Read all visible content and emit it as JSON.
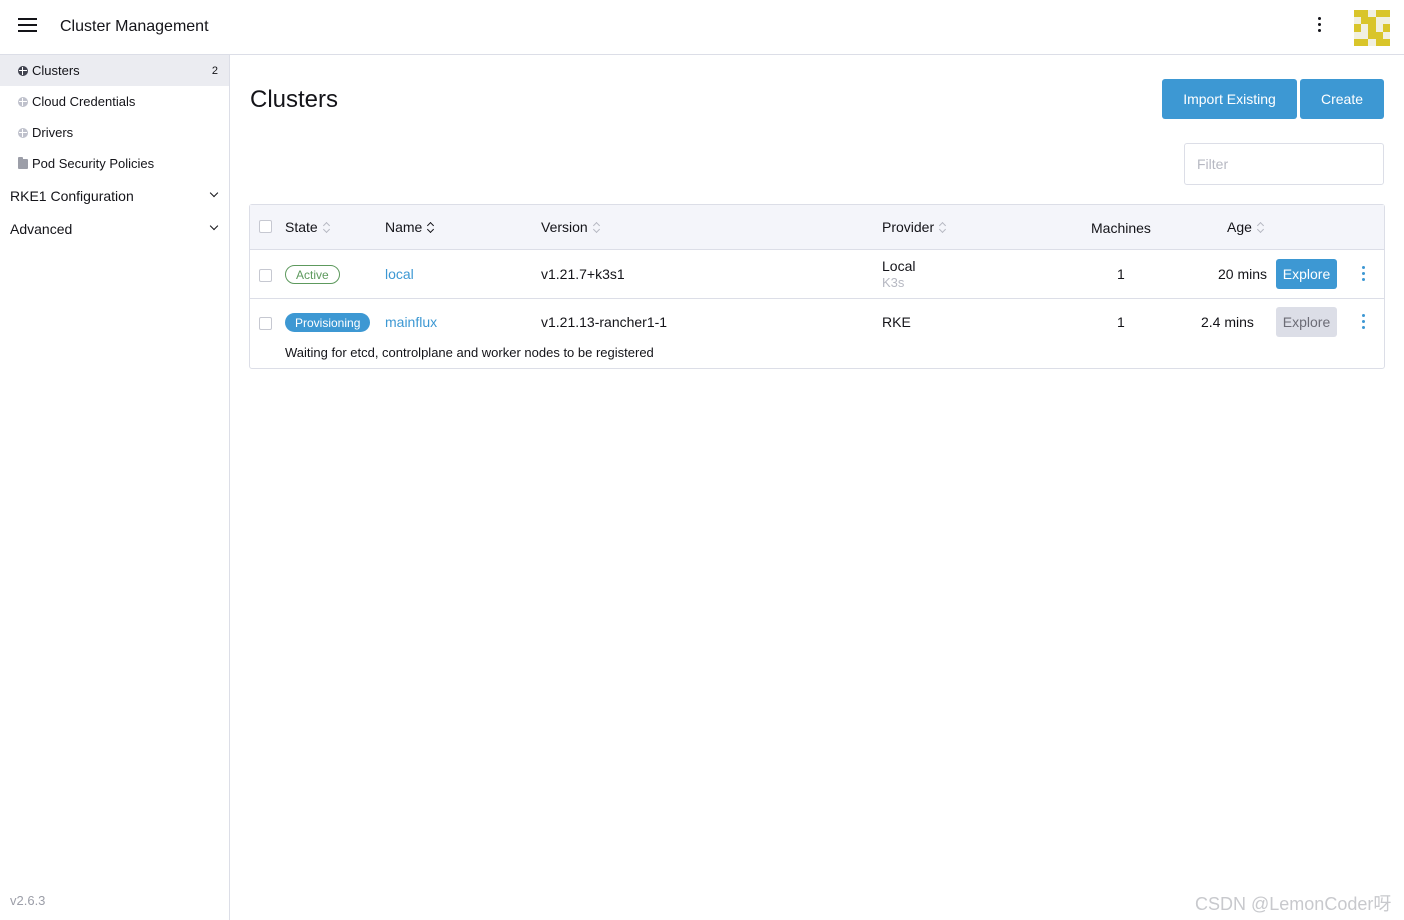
{
  "header": {
    "title": "Cluster Management",
    "menu_icon": "hamburger-icon",
    "more_icon": "kebab-icon",
    "avatar_colors": {
      "fg": "#d9c52a",
      "bg": "#f1f0e0"
    }
  },
  "sidebar": {
    "items": [
      {
        "label": "Clusters",
        "count": "2",
        "icon": "globe-icon",
        "active": true
      },
      {
        "label": "Cloud Credentials",
        "icon": "globe-icon"
      },
      {
        "label": "Drivers",
        "icon": "globe-icon"
      },
      {
        "label": "Pod Security Policies",
        "icon": "folder-icon"
      }
    ],
    "groups": [
      {
        "label": "RKE1 Configuration",
        "icon": "chevron-down-icon"
      },
      {
        "label": "Advanced",
        "icon": "chevron-down-icon"
      }
    ],
    "version": "v2.6.3"
  },
  "main": {
    "title": "Clusters",
    "import_label": "Import Existing",
    "create_label": "Create",
    "filter_placeholder": "Filter",
    "accent_color": "#3d98d3",
    "table": {
      "columns": [
        "State",
        "Name",
        "Version",
        "Provider",
        "Machines",
        "Age"
      ],
      "rows": [
        {
          "state": "Active",
          "name": "local",
          "version": "v1.21.7+k3s1",
          "provider": "Local",
          "provider_sub": "K3s",
          "machines": "1",
          "age": "20 mins",
          "action": "Explore"
        },
        {
          "state": "Provisioning",
          "name": "mainflux",
          "version": "v1.21.13-rancher1-1",
          "provider": "RKE",
          "machines": "1",
          "age": "2.4 mins",
          "action": "Explore",
          "message": "Waiting for etcd, controlplane and worker nodes to be registered"
        }
      ]
    }
  },
  "watermark": "CSDN @LemonCoder呀"
}
